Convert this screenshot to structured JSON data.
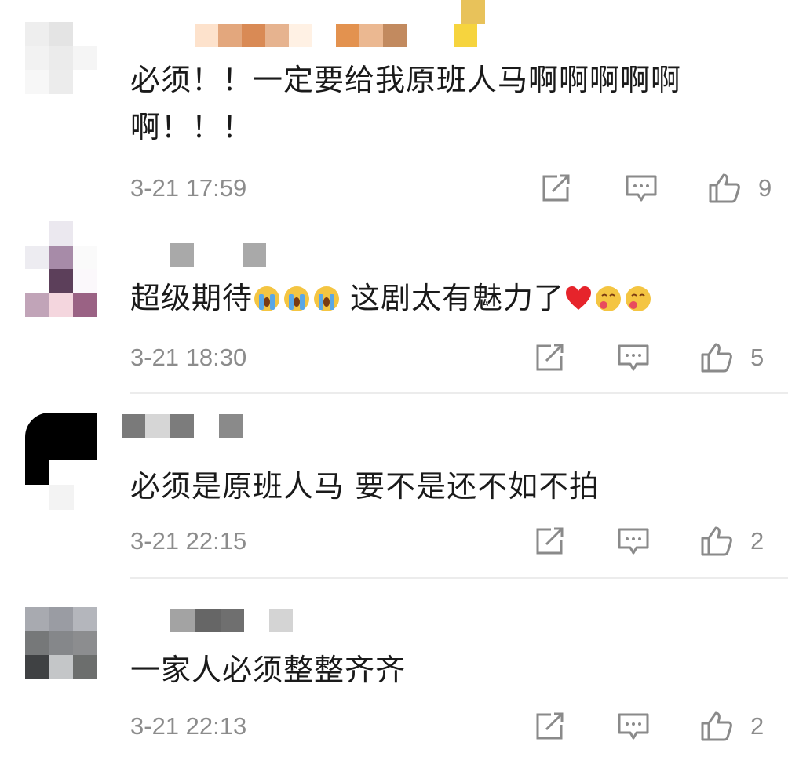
{
  "comments": [
    {
      "text_lines": [
        "必须！！一定要给我原班人马啊啊啊啊啊",
        "啊！！！"
      ],
      "time": "3-21 17:59",
      "likes": "9",
      "avatar_colors": [
        "#f2f2f2",
        "#e6e6e6",
        "#ffffff",
        "#ececec",
        "#f7f7f7",
        "#e2e2e2",
        "#f4f4f4",
        "#ffffff",
        "#eeeeee"
      ],
      "name_blocks": [
        "#fde0c8",
        "#e3a77d",
        "#d98a55",
        "#e8b48f",
        "#fff1e4",
        "#ffffff",
        "#e3924f",
        "#ebb891",
        "#c28a5f",
        "#ffffff",
        "#ffffff",
        "#f6d43e"
      ]
    },
    {
      "text": "超级期待",
      "text2": "这剧太有魅力了",
      "time": "3-21 18:30",
      "likes": "5",
      "avatar_colors": [
        "#ffffff",
        "#e8e6ee",
        "#ffffff",
        "#ecebf0",
        "#a78ba8",
        "#fafafa",
        "#ffffff",
        "#5c3f5a",
        "#fbf8fb",
        "#c1a4b8",
        "#f4d6de",
        "#9a6284"
      ],
      "name_blocks": [
        "#ffffff",
        "#ffffff",
        "#a9a9a9",
        "#ffffff",
        "#ffffff",
        "#a9a9a9"
      ]
    },
    {
      "text": "必须是原班人马 要不是还不如不拍",
      "time": "3-21 22:15",
      "likes": "2",
      "avatar_colors": [
        "#000000",
        "#000000",
        "#000000",
        "#000000",
        "#000000",
        "#000000",
        "#000000",
        "#ffffff",
        "#ffffff"
      ],
      "name_blocks": [
        "#7a7a7a",
        "#d6d6d6",
        "#7c7c7c",
        "#ffffff",
        "#8a8a8a"
      ]
    },
    {
      "text": "一家人必须整整齐齐",
      "time": "3-21 22:13",
      "likes": "2",
      "avatar_colors": [
        "#a8aab0",
        "#9a9ca3",
        "#b4b6bc",
        "#767879",
        "#85878a",
        "#8c8d8f",
        "#3f4143",
        "#c4c6c8",
        "#6c6e6d"
      ],
      "name_blocks": [
        "#ffffff",
        "#a3a3a3",
        "#666666",
        "#6f6f6f",
        "#ffffff",
        "#d4d4d4"
      ]
    }
  ],
  "icons": {
    "share": "share-icon",
    "reply": "reply-icon",
    "like": "like-icon"
  },
  "colors": {
    "text": "#1a1a1a",
    "meta": "#8c8c8c",
    "divider": "#ececec",
    "icon": "#8a8a8a"
  }
}
